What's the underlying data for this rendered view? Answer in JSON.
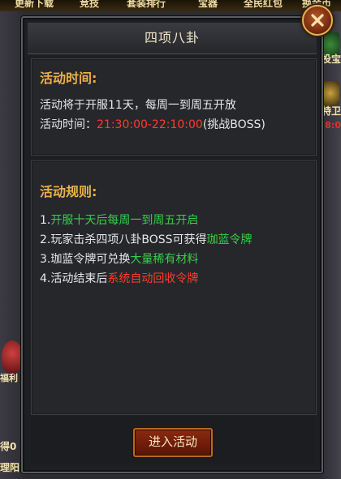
{
  "background": {
    "top_menu": [
      "更新下载",
      "竞技",
      "套装排行",
      "宝器",
      "全民红包",
      "换金币"
    ],
    "right_labels": [
      "投宝",
      "特卫",
      "8:0"
    ],
    "left_labels": [
      "福利",
      "得0",
      "理阳"
    ]
  },
  "dialog": {
    "title": "四项八卦",
    "close_icon": "close-icon",
    "time_section": {
      "heading": "活动时间:",
      "line1": "活动将于开服11天，每周一到周五开放",
      "line2_prefix": "活动时间：",
      "line2_time": "21:30:00-22:10:00",
      "line2_suffix": "(挑战BOSS)"
    },
    "rules_section": {
      "heading": "活动规则:",
      "rules": [
        {
          "a": "1.",
          "b": "开服十天后每周一到周五开启",
          "c": ""
        },
        {
          "a": "2.玩家击杀四项八卦BOSS可获得",
          "b": "珈蓝令牌",
          "c": ""
        },
        {
          "a": "3.珈蓝令牌可兑换",
          "b": "大量稀有材料",
          "c": ""
        },
        {
          "a": "4.活动结束后",
          "b": "系统自动回收令牌",
          "c": ""
        }
      ]
    },
    "enter_button": "进入活动"
  },
  "colors": {
    "heading": "#e9b24b",
    "highlight_red": "#ff3b2f",
    "highlight_green": "#35d04a",
    "text": "#e8e8e8"
  }
}
